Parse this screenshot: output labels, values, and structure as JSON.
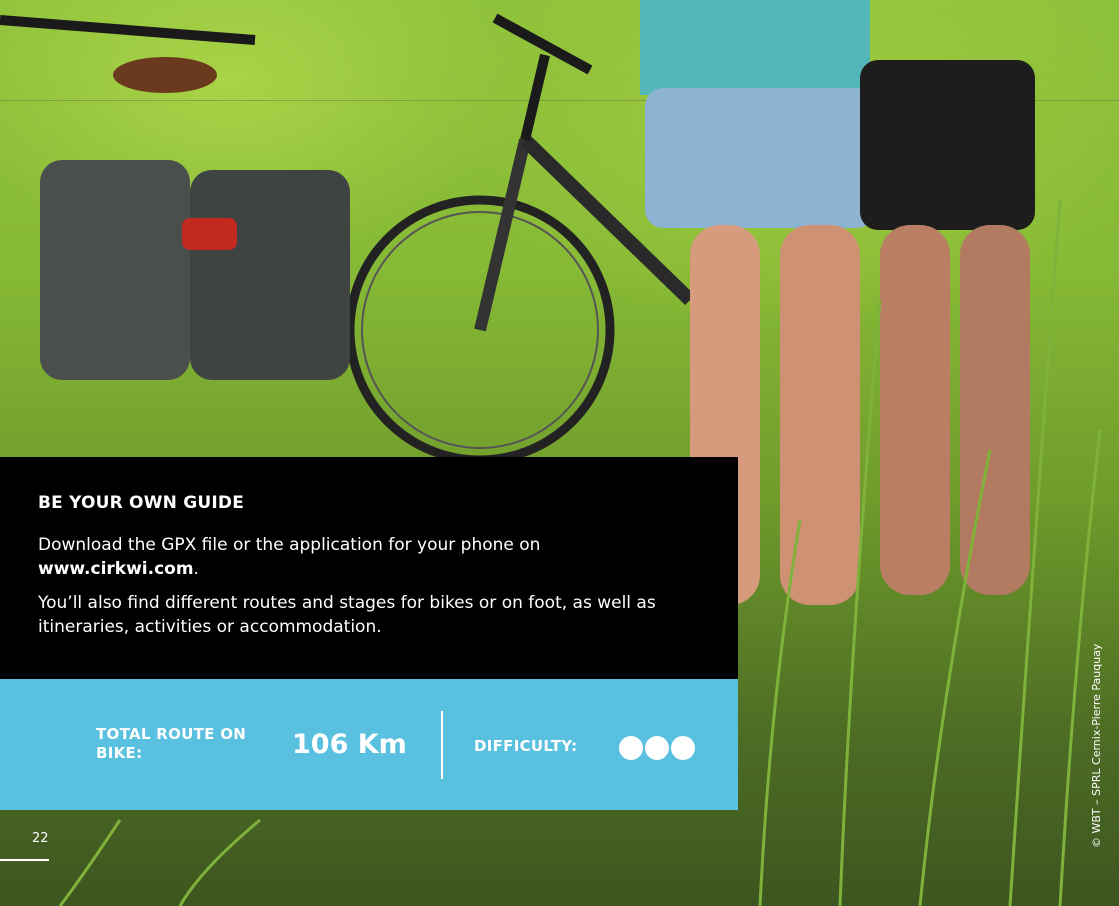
{
  "info": {
    "title": "BE YOUR OWN GUIDE",
    "para1_text": "Download the GPX file or the application for your phone on",
    "para1_link": "www.cirkwi.com",
    "para1_end": ".",
    "para2": "You’ll also find different routes and stages for bikes or on foot, as well as itineraries, activities or accommodation."
  },
  "stats": {
    "route_label": "TOTAL ROUTE ON BIKE:",
    "route_value": "106 Km",
    "difficulty_label": "DIFFICULTY:",
    "difficulty_level": 3,
    "difficulty_max": 3
  },
  "page": {
    "number": "22"
  },
  "credit": "© WBT – SPRL Cernix-Pierre Pauquay",
  "colors": {
    "panel": "#000000",
    "stats_bar": "#5ac0df",
    "text": "#ffffff"
  },
  "icons": {
    "difficulty": "filled-circle"
  }
}
